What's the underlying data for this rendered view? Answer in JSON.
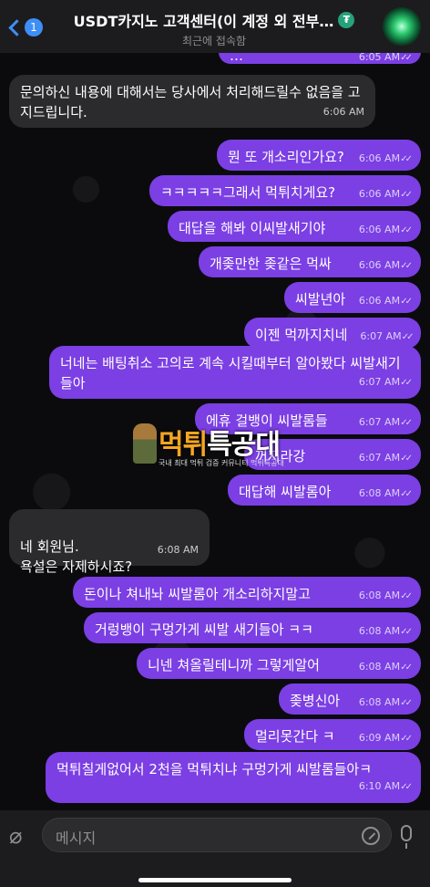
{
  "header": {
    "back_count": "1",
    "title": "USDT카지노 고객센터(이 계정 외 전부…",
    "title_badge": "₮",
    "subtitle": "최근에 접속함"
  },
  "messages": [
    {
      "dir": "out",
      "text": "…",
      "time": "6:05 AM"
    },
    {
      "dir": "in",
      "text": "문의하신 내용에 대해서는 당사에서 처리해드릴수 없음을 고지드립니다.",
      "time": "6:06 AM"
    },
    {
      "dir": "out",
      "text": "뭔 또 개소리인가요?",
      "time": "6:06 AM"
    },
    {
      "dir": "out",
      "text": "ㅋㅋㅋㅋㅋ그래서 먹튀치게요?",
      "time": "6:06 AM"
    },
    {
      "dir": "out",
      "text": "대답을 해봐 이씨발새기야",
      "time": "6:06 AM"
    },
    {
      "dir": "out",
      "text": "개좆만한 좆같은 먹싸",
      "time": "6:06 AM"
    },
    {
      "dir": "out",
      "text": "씨발년아",
      "time": "6:06 AM"
    },
    {
      "dir": "out",
      "text": "이젠 먹까지치네",
      "time": "6:07 AM"
    },
    {
      "dir": "out",
      "text": "너네는 배팅취소 고의로 계속 시킬때부터 알아봤다 씨발새기들아",
      "time": "6:07 AM"
    },
    {
      "dir": "out",
      "text": "에휴 걸뱅이 씨발롬들",
      "time": "6:07 AM"
    },
    {
      "dir": "out",
      "text": "꺼져라강",
      "time": "6:07 AM"
    },
    {
      "dir": "out",
      "text": "대답해 씨발롬아",
      "time": "6:08 AM"
    },
    {
      "dir": "in",
      "text": "네 회원님.\n욕설은 자제하시죠?",
      "time": "6:08 AM"
    },
    {
      "dir": "out",
      "text": "돈이나 쳐내놔 씨발롬아 개소리하지말고",
      "time": "6:08 AM"
    },
    {
      "dir": "out",
      "text": "거렁뱅이 구멍가게 씨발 새기들아 ㅋㅋ",
      "time": "6:08 AM"
    },
    {
      "dir": "out",
      "text": "니넨 쳐올릴테니까 그렇게알어",
      "time": "6:08 AM"
    },
    {
      "dir": "out",
      "text": "좆병신아",
      "time": "6:08 AM"
    },
    {
      "dir": "out",
      "text": "멀리못간다 ㅋ",
      "time": "6:09 AM"
    },
    {
      "dir": "out",
      "text": "먹튀칠게없어서 2천을 먹튀치냐 구멍가게 씨발롬들아ㅋ",
      "time": "6:10 AM"
    }
  ],
  "watermark": {
    "name_a": "먹튀",
    "name_b": "특공대",
    "tagline": "국내 최대 먹튀 검증 커뮤니티 먹튀특공대"
  },
  "input": {
    "placeholder": "메시지"
  },
  "colors": {
    "outgoing_bubble": "#7b3fe4",
    "incoming_bubble": "#2b2b2e",
    "accent": "#3e8ef7"
  }
}
